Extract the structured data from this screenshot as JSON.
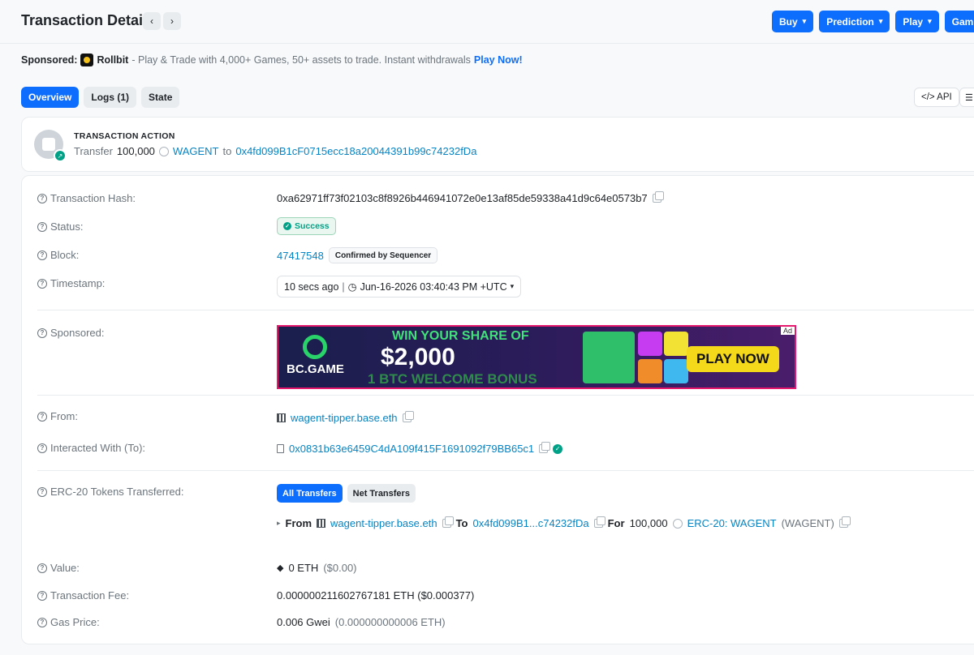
{
  "header": {
    "title": "Transaction Details",
    "prev_icon": "chevron-left-icon",
    "next_icon": "chevron-right-icon",
    "menu": [
      {
        "label": "Buy"
      },
      {
        "label": "Prediction"
      },
      {
        "label": "Play"
      },
      {
        "label": "Gaming"
      }
    ]
  },
  "sponsored": {
    "label": "Sponsored:",
    "brand": "Rollbit",
    "text": "- Play & Trade with 4,000+ Games, 50+ assets to trade. Instant withdrawals",
    "cta": "Play Now!"
  },
  "tabs": [
    {
      "label": "Overview",
      "active": true
    },
    {
      "label": "Logs (1)",
      "active": false
    },
    {
      "label": "State",
      "active": false
    }
  ],
  "api_button": "</> API",
  "action": {
    "title": "TRANSACTION ACTION",
    "verb": "Transfer",
    "amount": "100,000",
    "token": "WAGENT",
    "to_word": "to",
    "to_address": "0x4fd099B1cF0715ecc18a20044391b99c74232fDa"
  },
  "details": {
    "hash_label": "Transaction Hash:",
    "hash": "0xa62971ff73f02103c8f8926b446941072e0e13af85de59338a41d9c64e0573b7",
    "status_label": "Status:",
    "status": "Success",
    "block_label": "Block:",
    "block": "47417548",
    "block_badge": "Confirmed by Sequencer",
    "timestamp_label": "Timestamp:",
    "timestamp_ago": "10 secs ago",
    "timestamp_full": "Jun-16-2026 03:40:43 PM +UTC",
    "sponsored_label": "Sponsored:",
    "from_label": "From:",
    "from": "wagent-tipper.base.eth",
    "to_label": "Interacted With (To):",
    "to": "0x0831b63e6459C4dA109f415F1691092f79BB65c1",
    "erc20_label": "ERC-20 Tokens Transferred:",
    "all_transfers": "All Transfers",
    "net_transfers": "Net Transfers",
    "transfer": {
      "from_word": "From",
      "from": "wagent-tipper.base.eth",
      "to_word": "To",
      "to": "0x4fd099B1...c74232fDa",
      "for_word": "For",
      "amount": "100,000",
      "token": "ERC-20: WAGENT",
      "symbol": "(WAGENT)"
    },
    "value_label": "Value:",
    "value": "0 ETH",
    "value_usd": "($0.00)",
    "fee_label": "Transaction Fee:",
    "fee": "0.000000211602767181 ETH ($0.000377)",
    "gas_label": "Gas Price:",
    "gas": "0.006 Gwei",
    "gas_eth": "(0.000000000006 ETH)"
  },
  "ad": {
    "brand": "BC.GAME",
    "headline": "WIN YOUR SHARE OF",
    "amount": "$2,000",
    "sub": "1 BTC WELCOME BONUS",
    "cta": "PLAY NOW",
    "tag": "Ad"
  },
  "colors": {
    "accent": "#0d6efd",
    "link": "#0784c3",
    "success": "#00a186"
  }
}
